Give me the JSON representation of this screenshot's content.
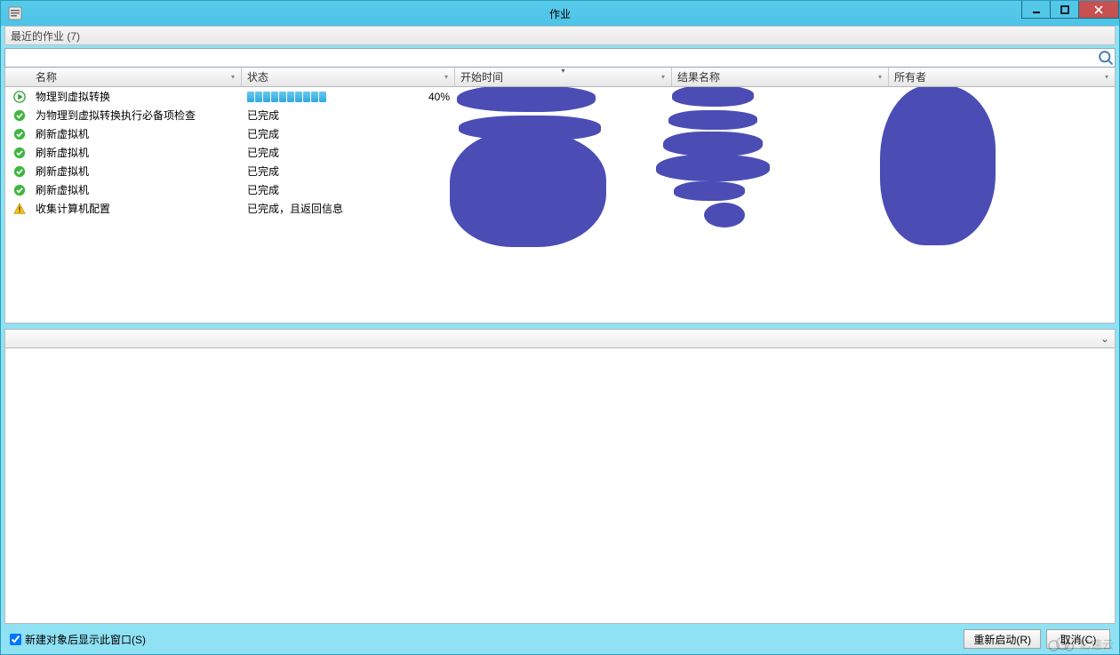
{
  "window": {
    "title": "作业"
  },
  "recent": {
    "label": "最近的作业 (7)"
  },
  "search": {
    "placeholder": ""
  },
  "columns": {
    "name": "名称",
    "status": "状态",
    "start": "开始时间",
    "result": "结果名称",
    "owner": "所有者"
  },
  "icons": {
    "running": "running-icon",
    "ok": "ok-icon",
    "warn": "warn-icon"
  },
  "progress": {
    "pct_label": "40%",
    "pct": 40
  },
  "rows": [
    {
      "icon": "running",
      "name": "物理到虚拟转换",
      "status_type": "progress"
    },
    {
      "icon": "ok",
      "name": "为物理到虚拟转换执行必备项检查",
      "status": "已完成"
    },
    {
      "icon": "ok",
      "name": "刷新虚拟机",
      "status": "已完成"
    },
    {
      "icon": "ok",
      "name": "刷新虚拟机",
      "status": "已完成"
    },
    {
      "icon": "ok",
      "name": "刷新虚拟机",
      "status": "已完成"
    },
    {
      "icon": "ok",
      "name": "刷新虚拟机",
      "status": "已完成"
    },
    {
      "icon": "warn",
      "name": "收集计算机配置",
      "status": "已完成，且返回信息"
    }
  ],
  "footer": {
    "checkbox_label": "新建对象后显示此窗口(S)",
    "checked": true,
    "restart": "重新启动(R)",
    "cancel": "取消(C)"
  },
  "watermark": "亿速云"
}
